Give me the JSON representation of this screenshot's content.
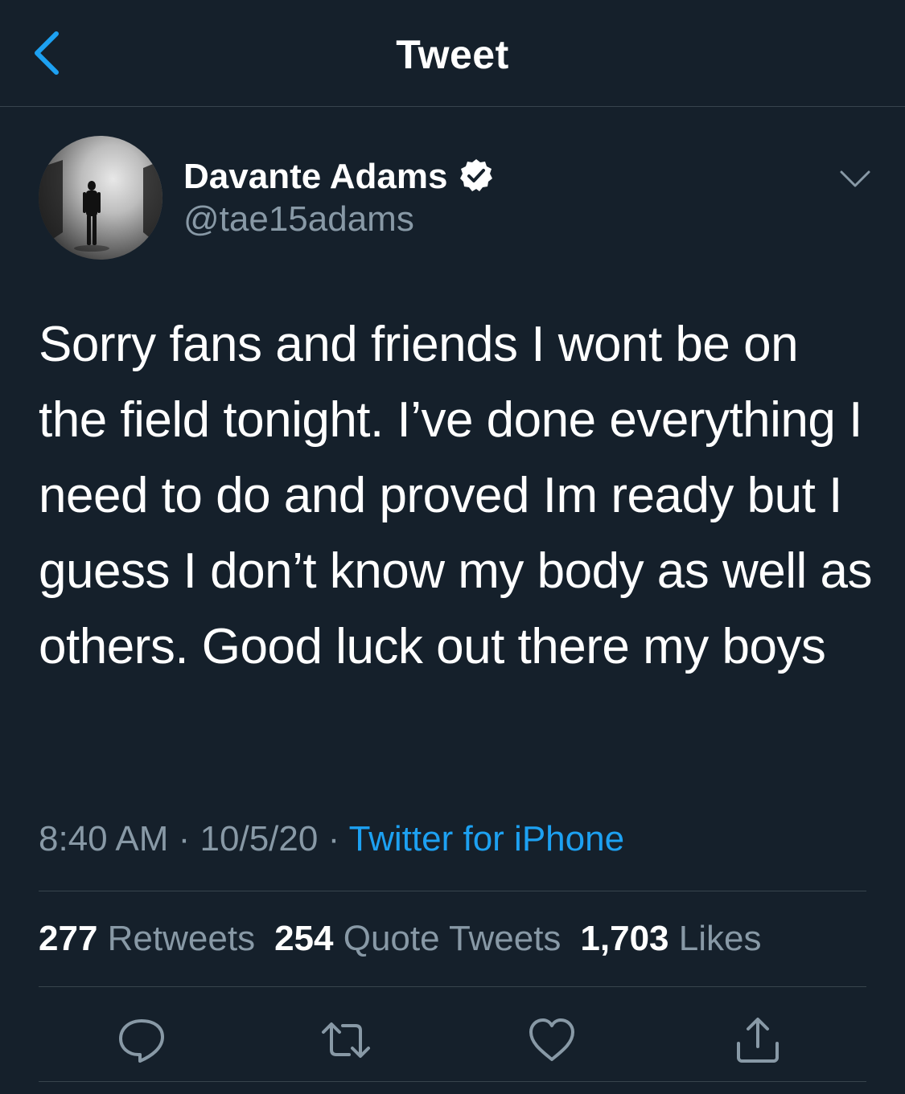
{
  "header": {
    "title": "Tweet"
  },
  "author": {
    "display_name": "Davante Adams",
    "handle": "@tae15adams",
    "verified": true
  },
  "tweet": {
    "text": "Sorry fans and friends I wont be on the field tonight. I’ve done everything I need to do and proved Im ready but I guess I don’t know my body as well as others. Good luck out there my boys",
    "time": "8:40 AM",
    "date": "10/5/20",
    "separator": " · ",
    "source": "Twitter for iPhone"
  },
  "stats": {
    "retweets_count": "277",
    "retweets_label": "Retweets",
    "quotes_count": "254",
    "quotes_label": "Quote Tweets",
    "likes_count": "1,703",
    "likes_label": "Likes"
  },
  "icons": {
    "back": "chevron-left-icon",
    "more": "chevron-down-icon",
    "verified": "verified-badge-icon",
    "reply": "reply-icon",
    "retweet": "retweet-icon",
    "like": "heart-icon",
    "share": "share-icon"
  },
  "colors": {
    "background": "#15202b",
    "accent": "#1da1f2",
    "secondary_text": "#8899a6",
    "divider": "#38444d"
  }
}
